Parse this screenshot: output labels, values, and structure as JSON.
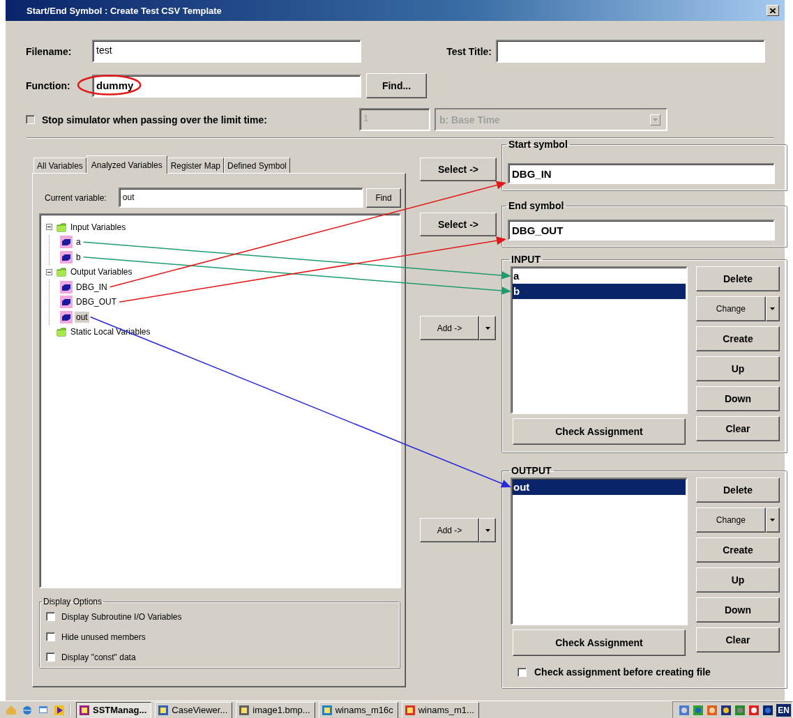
{
  "window": {
    "title": "Start/End Symbol : Create Test CSV Template"
  },
  "filename": {
    "label": "Filename:",
    "value": "test"
  },
  "test_title": {
    "label": "Test Title:"
  },
  "function": {
    "label": "Function:",
    "value": "dummy",
    "button": "Find...",
    "color": "#e01818"
  },
  "limit": {
    "checked": false,
    "label": "Stop simulator when passing over the limit time:",
    "value": "1",
    "unit": "b: Base Time",
    "disabled": true
  },
  "tabs": [
    {
      "label": "All Variables",
      "selected": false
    },
    {
      "label": "Analyzed Variables",
      "selected": true
    },
    {
      "label": "Register Map",
      "selected": false
    },
    {
      "label": "Defined Symbol",
      "selected": false
    }
  ],
  "current_variable": {
    "label": "Current variable:",
    "value": "out",
    "button": "Find"
  },
  "tree": [
    {
      "label": "Input Variables",
      "expanded": true,
      "selected": false,
      "children": [
        {
          "label": "a",
          "selected": false,
          "color": "#1f9a6a"
        },
        {
          "label": "b",
          "selected": false,
          "color": "#1f9a6a"
        }
      ]
    },
    {
      "label": "Output Variables",
      "expanded": true,
      "selected": false,
      "children": [
        {
          "label": "DBG_IN",
          "selected": false,
          "color": "#e01818"
        },
        {
          "label": "DBG_OUT",
          "selected": false,
          "color": "#e01818"
        },
        {
          "label": "out",
          "selected": true,
          "color": "#2a2ad8"
        }
      ]
    },
    {
      "label": "Static Local Variables",
      "selected": false
    }
  ],
  "display_options": {
    "title": "Display Options",
    "options": [
      {
        "label": "Display Subroutine I/O Variables",
        "checked": false
      },
      {
        "label": "Hide unused members",
        "checked": false
      },
      {
        "label": "Display \"const\" data",
        "checked": false
      }
    ]
  },
  "start_symbol": {
    "title": "Start symbol",
    "button": "Select ->",
    "value": "DBG_IN",
    "color": "#e01818"
  },
  "end_symbol": {
    "title": "End symbol",
    "button": "Select ->",
    "value": "DBG_OUT",
    "color": "#e01818"
  },
  "input": {
    "title": "INPUT",
    "add_button": "Add ->",
    "items": [
      {
        "label": "a",
        "selected": false,
        "color": "#1f9a6a"
      },
      {
        "label": "b",
        "selected": true,
        "color": "#1f9a6a"
      }
    ],
    "buttons": [
      {
        "label": "Delete",
        "kind": "plain"
      },
      {
        "label": "Change",
        "kind": "split"
      },
      {
        "label": "Create",
        "kind": "plain"
      },
      {
        "label": "Up",
        "kind": "plain"
      },
      {
        "label": "Down",
        "kind": "plain"
      }
    ],
    "check_button": "Check Assignment",
    "clear_button": "Clear"
  },
  "output": {
    "title": "OUTPUT",
    "add_button": "Add ->",
    "items": [
      {
        "label": "out",
        "selected": true,
        "color": "#2a2ad8"
      }
    ],
    "buttons": [
      {
        "label": "Delete",
        "kind": "plain"
      },
      {
        "label": "Change",
        "kind": "split"
      },
      {
        "label": "Create",
        "kind": "plain"
      },
      {
        "label": "Up",
        "kind": "plain"
      },
      {
        "label": "Down",
        "kind": "plain"
      }
    ],
    "check_button": "Check Assignment",
    "clear_button": "Clear",
    "check_before": {
      "label": "Check assignment before creating file",
      "checked": false
    }
  },
  "taskbar": {
    "tasks": [
      {
        "label": "SSTManag...",
        "selected": true
      },
      {
        "label": "CaseViewer...",
        "selected": false
      },
      {
        "label": "image1.bmp...",
        "selected": false
      },
      {
        "label": "winams_m16c",
        "selected": false
      },
      {
        "label": "winams_m1...",
        "selected": false
      }
    ],
    "language": "EN"
  }
}
